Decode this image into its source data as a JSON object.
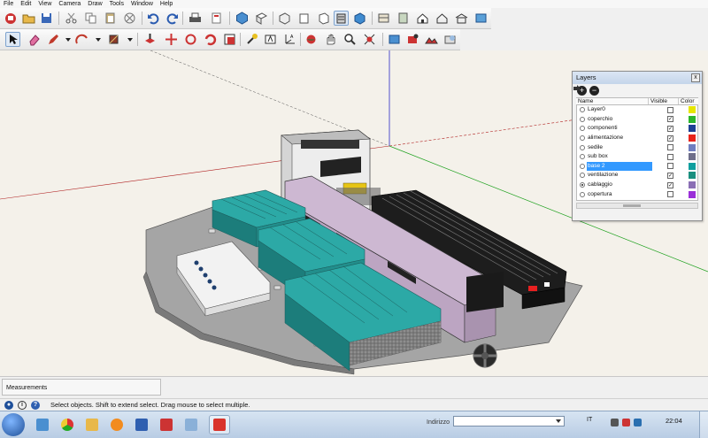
{
  "menubar": {
    "items": [
      "File",
      "Edit",
      "View",
      "Camera",
      "Draw",
      "Tools",
      "Window",
      "Help"
    ]
  },
  "toolbar1": {
    "icons": [
      "getting-started-icon",
      "open-icon",
      "save-icon",
      "cut-icon",
      "copy-icon",
      "paste-icon",
      "erase-icon",
      "undo-icon",
      "redo-icon",
      "print-icon",
      "model-info-icon",
      "iso-view-icon",
      "top-view-icon",
      "front-view-icon",
      "right-view-icon",
      "back-view-icon",
      "left-view-icon",
      "xray-icon",
      "wireframe-icon",
      "hidden-line-icon",
      "shaded-icon",
      "shaded-textures-icon",
      "monochrome-icon",
      "house-icon",
      "house-outline-icon",
      "warehouse-icon",
      "share-icon"
    ]
  },
  "toolbar2": {
    "icons": [
      "select-icon",
      "eraser-icon",
      "pencil-icon",
      "arc-icon",
      "paint-bucket-icon",
      "push-pull-icon",
      "move-icon",
      "rotate-icon",
      "scale-icon",
      "tape-measure-icon",
      "text-icon",
      "axes-icon",
      "orbit-icon",
      "pan-icon",
      "zoom-icon",
      "zoom-extents-icon",
      "photo-textures-icon",
      "add-location-icon",
      "toggle-terrain-icon",
      "preview-google-earth-icon"
    ]
  },
  "layers_panel": {
    "title": "Layers",
    "close_label": "x",
    "add_label": "+",
    "remove_label": "−",
    "headers": {
      "name": "Name",
      "visible": "Visible",
      "color": "Color"
    },
    "rows": [
      {
        "name": "Layer0",
        "visible": false,
        "active": false,
        "color": "#e6e600"
      },
      {
        "name": "coperchio",
        "visible": true,
        "active": false,
        "color": "#2bb52b"
      },
      {
        "name": "componenti",
        "visible": true,
        "active": false,
        "color": "#1c3f94"
      },
      {
        "name": "alimentazione",
        "visible": true,
        "active": false,
        "color": "#e8231a"
      },
      {
        "name": "sedile",
        "visible": false,
        "active": false,
        "color": "#6f7dbf"
      },
      {
        "name": "sub box",
        "visible": false,
        "active": false,
        "color": "#6e6e8a"
      },
      {
        "name": "base 2",
        "visible": false,
        "active": false,
        "color": "#109f9f",
        "selected": true
      },
      {
        "name": "ventilazione",
        "visible": true,
        "active": false,
        "color": "#1a8f7f"
      },
      {
        "name": "cablaggio",
        "visible": true,
        "active": true,
        "color": "#8a6fb5"
      },
      {
        "name": "copertura",
        "visible": false,
        "active": false,
        "color": "#9a2fd8"
      }
    ]
  },
  "measurements": {
    "label": "Measurements"
  },
  "status": {
    "text": "Select objects. Shift to extend select. Drag mouse to select multiple.",
    "icons": [
      "geo-location-icon",
      "info-icon",
      "help-icon"
    ]
  },
  "taskbar": {
    "address_label": "Indirizzo",
    "address_value": "",
    "language": "IT",
    "clock": "22:04",
    "apps": [
      "windows-explorer-icon",
      "chrome-icon",
      "folder-icon",
      "media-player-icon",
      "app-icon",
      "sketchup-icon",
      "file-manager-icon",
      "sketchup-active-icon"
    ]
  },
  "colors": {
    "teal": "#1f9a98",
    "lilac": "#cdb8d2",
    "plate": "#9a9a9a",
    "sky": "#f4f1ea",
    "axis_red": "#b02020",
    "axis_green": "#1fa11f",
    "axis_blue": "#2c2cc8"
  }
}
